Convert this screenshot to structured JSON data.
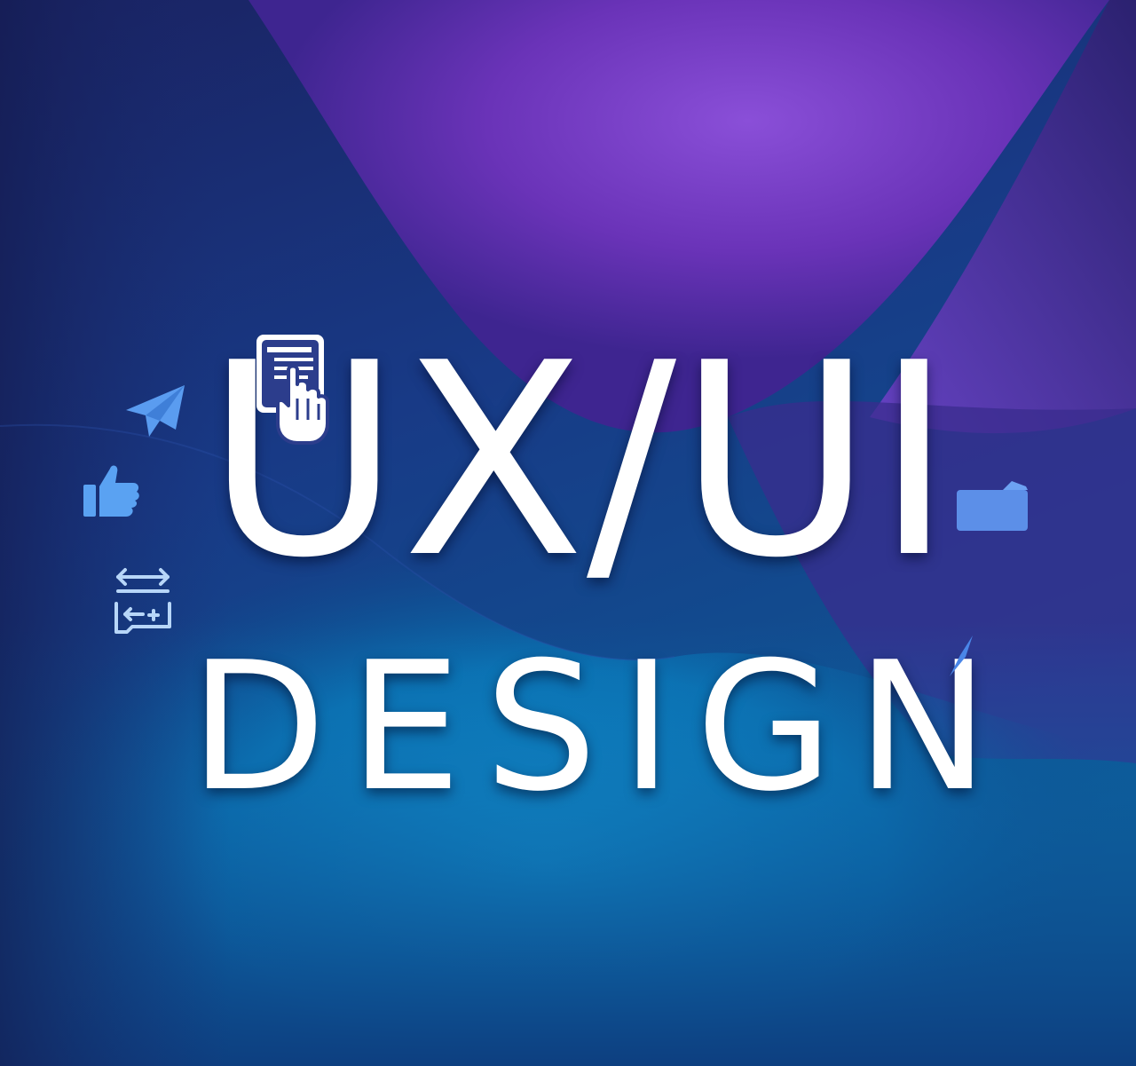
{
  "headline": {
    "line1": "UX/UI",
    "line2": "DESIGN"
  },
  "colors": {
    "purple": "#7a3fcc",
    "deep_navy": "#1c2a66",
    "ocean_blue": "#0b87c4",
    "icon_blue": "#4a90e8",
    "text": "#ffffff"
  },
  "icons": [
    "tap-document-icon",
    "paper-plane-icon",
    "thumbs-up-icon",
    "swap-arrows-icon",
    "folder-card-icon",
    "pen-accent-icon"
  ]
}
